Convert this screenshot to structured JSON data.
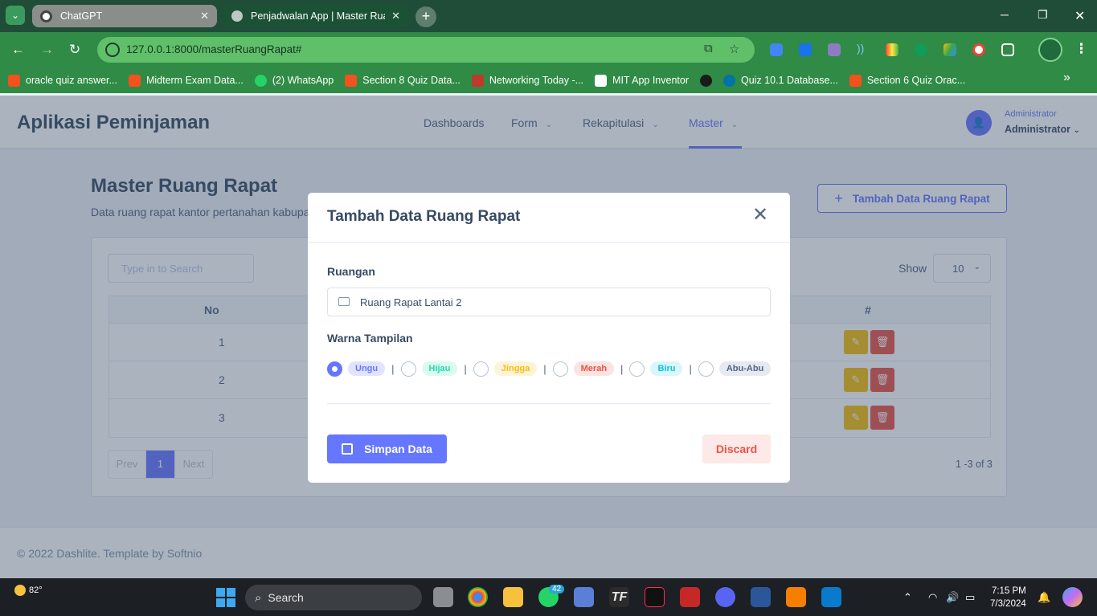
{
  "browser": {
    "tabs": [
      {
        "title": "ChatGPT",
        "active": false
      },
      {
        "title": "Penjadwalan App | Master Ruang",
        "active": true
      }
    ],
    "url": "127.0.0.1:8000/masterRuangRapat#",
    "bookmarks": [
      {
        "label": "oracle quiz answer...",
        "color": "#f4511e"
      },
      {
        "label": "Midterm Exam Data...",
        "color": "#f4511e"
      },
      {
        "label": "(2) WhatsApp",
        "color": "#25d366"
      },
      {
        "label": "Section 8 Quiz Data...",
        "color": "#f4511e"
      },
      {
        "label": "Networking Today -...",
        "color": "#c0392b"
      },
      {
        "label": "MIT App Inventor",
        "color": "#ffffff"
      },
      {
        "label": "",
        "color": "#1b1b1b"
      },
      {
        "label": "Quiz 10.1 Database...",
        "color": "#0073aa"
      },
      {
        "label": "Section 6 Quiz Orac...",
        "color": "#f4511e"
      }
    ]
  },
  "app": {
    "brand": "Aplikasi Peminjaman",
    "nav": [
      {
        "label": "Dashboards",
        "dropdown": false,
        "active": false
      },
      {
        "label": "Form",
        "dropdown": true,
        "active": false
      },
      {
        "label": "Rekapitulasi",
        "dropdown": true,
        "active": false
      },
      {
        "label": "Master",
        "dropdown": true,
        "active": true
      }
    ],
    "user": {
      "role": "Administrator",
      "name": "Administrator"
    },
    "page_title": "Master Ruang Rapat",
    "page_subtitle": "Data ruang rapat kantor pertanahan kabupa",
    "add_button": "Tambah Data Ruang Rapat",
    "table": {
      "search_placeholder": "Type in to Search",
      "show_label": "Show",
      "show_value": "10",
      "headers": {
        "no": "No",
        "actions": "#"
      },
      "rows": [
        {
          "no": "1"
        },
        {
          "no": "2"
        },
        {
          "no": "3"
        }
      ],
      "pagination": {
        "prev": "Prev",
        "current": "1",
        "next": "Next"
      },
      "count": "1 -3 of 3"
    },
    "footer": "© 2022 Dashlite. Template by Softnio"
  },
  "modal": {
    "title": "Tambah Data Ruang Rapat",
    "room_label": "Ruangan",
    "room_value": "Ruang Rapat Lantai 2",
    "color_label": "Warna Tampilan",
    "colors": [
      {
        "label": "Ungu",
        "fg": "#6576ff",
        "bg": "#e0e4ff",
        "selected": true
      },
      {
        "label": "Hijau",
        "fg": "#1ee0ac",
        "bg": "#dcfaf1",
        "selected": false
      },
      {
        "label": "Jingga",
        "fg": "#f4bd0e",
        "bg": "#fdf4d8",
        "selected": false
      },
      {
        "label": "Merah",
        "fg": "#e85347",
        "bg": "#fbe3e1",
        "selected": false
      },
      {
        "label": "Biru",
        "fg": "#09c2de",
        "bg": "#daf6fa",
        "selected": false
      },
      {
        "label": "Abu-Abu",
        "fg": "#526484",
        "bg": "#e5e9f2",
        "selected": false
      }
    ],
    "save_label": "Simpan Data",
    "discard_label": "Discard"
  },
  "taskbar": {
    "temperature": "82°",
    "search": "Search",
    "badge": "42",
    "time": "7:15 PM",
    "date": "7/3/2024"
  }
}
